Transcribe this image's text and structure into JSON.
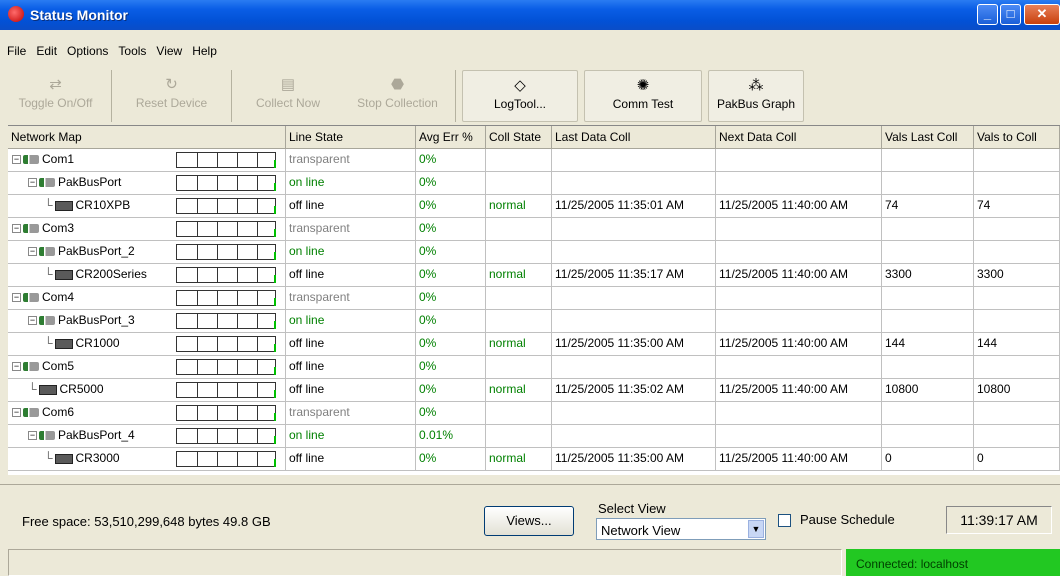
{
  "window": {
    "title": "Status Monitor"
  },
  "menu": [
    "File",
    "Edit",
    "Options",
    "Tools",
    "View",
    "Help"
  ],
  "toolbar": {
    "toggle_label": "Toggle On/Off",
    "reset_label": "Reset Device",
    "collect_label": "Collect Now",
    "stop_label": "Stop Collection",
    "logtool_label": "LogTool...",
    "commtest_label": "Comm Test",
    "pakbus_label": "PakBus Graph"
  },
  "grid": {
    "headers": [
      "Network Map",
      "Line State",
      "Avg Err %",
      "Coll State",
      "Last Data Coll",
      "Next Data Coll",
      "Vals Last Coll",
      "Vals to Coll"
    ],
    "rows": [
      {
        "name": "Com1",
        "level": 0,
        "icon": "port-icon",
        "line": "transparent",
        "avg": "0%",
        "coll": "",
        "last": "",
        "next": "",
        "vlast": "",
        "vto": ""
      },
      {
        "name": "PakBusPort",
        "level": 1,
        "icon": "port-icon",
        "line": "on line",
        "avg": "0%",
        "coll": "",
        "last": "",
        "next": "",
        "vlast": "",
        "vto": ""
      },
      {
        "name": "CR10XPB",
        "level": 2,
        "icon": "datalogger-icon",
        "line": "off line",
        "avg": "0%",
        "coll": "normal",
        "last": "11/25/2005 11:35:01 AM",
        "next": "11/25/2005 11:40:00 AM",
        "vlast": "74",
        "vto": "74"
      },
      {
        "name": "Com3",
        "level": 0,
        "icon": "port-icon",
        "line": "transparent",
        "avg": "0%",
        "coll": "",
        "last": "",
        "next": "",
        "vlast": "",
        "vto": ""
      },
      {
        "name": "PakBusPort_2",
        "level": 1,
        "icon": "port-icon",
        "line": "on line",
        "avg": "0%",
        "coll": "",
        "last": "",
        "next": "",
        "vlast": "",
        "vto": ""
      },
      {
        "name": "CR200Series",
        "level": 2,
        "icon": "datalogger-icon",
        "line": "off line",
        "avg": "0%",
        "coll": "normal",
        "last": "11/25/2005 11:35:17 AM",
        "next": "11/25/2005 11:40:00 AM",
        "vlast": "3300",
        "vto": "3300"
      },
      {
        "name": "Com4",
        "level": 0,
        "icon": "port-icon",
        "line": "transparent",
        "avg": "0%",
        "coll": "",
        "last": "",
        "next": "",
        "vlast": "",
        "vto": ""
      },
      {
        "name": "PakBusPort_3",
        "level": 1,
        "icon": "port-icon",
        "line": "on line",
        "avg": "0%",
        "coll": "",
        "last": "",
        "next": "",
        "vlast": "",
        "vto": ""
      },
      {
        "name": "CR1000",
        "level": 2,
        "icon": "datalogger-icon",
        "line": "off line",
        "avg": "0%",
        "coll": "normal",
        "last": "11/25/2005 11:35:00 AM",
        "next": "11/25/2005 11:40:00 AM",
        "vlast": "144",
        "vto": "144"
      },
      {
        "name": "Com5",
        "level": 0,
        "icon": "port-icon",
        "line": "off line",
        "avg": "0%",
        "coll": "",
        "last": "",
        "next": "",
        "vlast": "",
        "vto": ""
      },
      {
        "name": "CR5000",
        "level": 1,
        "icon": "datalogger-icon",
        "line": "off line",
        "avg": "0%",
        "coll": "normal",
        "last": "11/25/2005 11:35:02 AM",
        "next": "11/25/2005 11:40:00 AM",
        "vlast": "10800",
        "vto": "10800"
      },
      {
        "name": "Com6",
        "level": 0,
        "icon": "port-icon",
        "line": "transparent",
        "avg": "0%",
        "coll": "",
        "last": "",
        "next": "",
        "vlast": "",
        "vto": ""
      },
      {
        "name": "PakBusPort_4",
        "level": 1,
        "icon": "port-icon",
        "line": "on line",
        "avg": "0.01%",
        "coll": "",
        "last": "",
        "next": "",
        "vlast": "",
        "vto": ""
      },
      {
        "name": "CR3000",
        "level": 2,
        "icon": "datalogger-icon",
        "line": "off line",
        "avg": "0%",
        "coll": "normal",
        "last": "11/25/2005 11:35:00 AM",
        "next": "11/25/2005 11:40:00 AM",
        "vlast": "0",
        "vto": "0"
      }
    ]
  },
  "footer": {
    "free_space": "Free space: 53,510,299,648 bytes   49.8 GB",
    "views_label": "Views...",
    "select_view_label": "Select View",
    "select_view_value": "Network View",
    "pause_label": "Pause Schedule",
    "clock": "11:39:17 AM"
  },
  "status": {
    "connection": "Connected: localhost"
  },
  "colors": {
    "online": "#008000",
    "transparent": "#808080",
    "connected_bg": "#22c822"
  }
}
